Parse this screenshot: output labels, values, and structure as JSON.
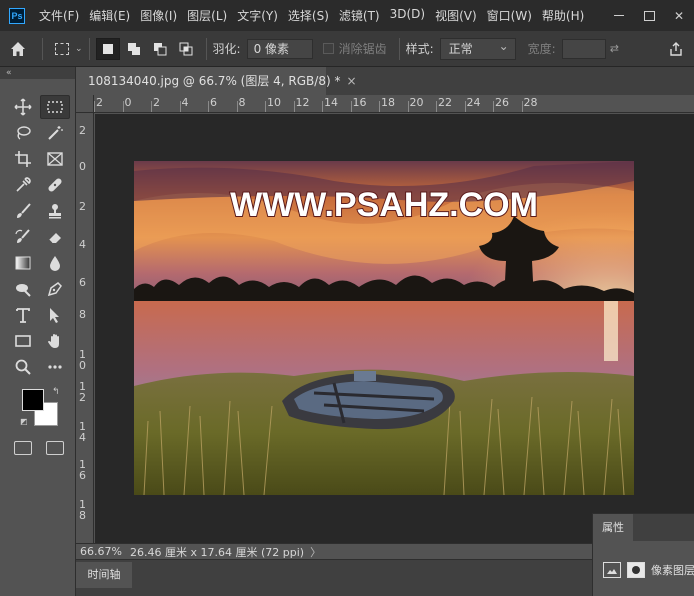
{
  "menubar": {
    "logo": "Ps",
    "items": [
      "文件(F)",
      "编辑(E)",
      "图像(I)",
      "图层(L)",
      "文字(Y)",
      "选择(S)",
      "滤镜(T)",
      "3D(D)",
      "视图(V)",
      "窗口(W)",
      "帮助(H)"
    ]
  },
  "options": {
    "feather_label": "羽化:",
    "feather_value": "0 像素",
    "antialias_label": "消除锯齿",
    "style_label": "样式:",
    "style_value": "正常",
    "width_label": "宽度:"
  },
  "toolbar": {
    "collapse": "«",
    "tools": [
      "move-icon",
      "marquee-icon",
      "lasso-icon",
      "magic-wand-icon",
      "crop-icon",
      "frame-icon",
      "eyedropper-icon",
      "healing-icon",
      "brush-icon",
      "stamp-icon",
      "history-brush-icon",
      "eraser-icon",
      "gradient-icon",
      "blur-icon",
      "dodge-icon",
      "pen-icon",
      "type-icon",
      "path-select-icon",
      "rectangle-icon",
      "hand-icon",
      "zoom-icon",
      "more-icon"
    ],
    "foreground_color": "#000000",
    "background_color": "#ffffff"
  },
  "document": {
    "tab_title": "108134040.jpg @ 66.7% (图层 4, RGB/8) *",
    "close": "×"
  },
  "rulers": {
    "h_labels": [
      "2",
      "0",
      "2",
      "4",
      "6",
      "8",
      "10",
      "12",
      "14",
      "16",
      "18",
      "20",
      "22",
      "24",
      "26",
      "28"
    ],
    "v_labels": [
      "2",
      "0",
      "2",
      "4",
      "6",
      "8",
      "1\n0",
      "1\n2",
      "1\n4",
      "1\n6",
      "1\n8"
    ]
  },
  "canvas": {
    "watermark": "WWW.PSAHZ.COM"
  },
  "status": {
    "zoom": "66.67%",
    "info": "26.46 厘米 x 17.64 厘米 (72 ppi)",
    "arrow": "〉"
  },
  "timeline": {
    "tab": "时间轴"
  },
  "properties": {
    "tab": "属性",
    "label": "像素图层"
  }
}
